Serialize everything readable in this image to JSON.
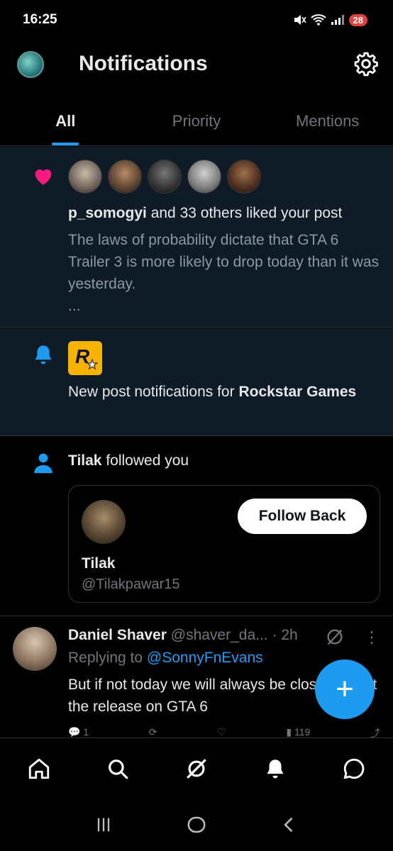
{
  "status_bar": {
    "time": "16:25",
    "battery": "28"
  },
  "header": {
    "title": "Notifications"
  },
  "tabs": [
    {
      "label": "All",
      "active": true
    },
    {
      "label": "Priority",
      "active": false
    },
    {
      "label": "Mentions",
      "active": false
    }
  ],
  "like_notification": {
    "user": "p_somogyi",
    "rest": " and 33 others liked your post",
    "preview": "The laws of probability dictate that GTA 6 Trailer 3 is more likely to drop today than it was yesterday.",
    "ellipsis": "..."
  },
  "post_notification": {
    "prefix": "New post notifications for ",
    "account": "Rockstar Games",
    "logo_letter": "R"
  },
  "follow_notification": {
    "user": "Tilak",
    "rest": " followed you",
    "card_name": "Tilak",
    "card_handle": "@Tilakpawar15",
    "button": "Follow Back"
  },
  "reply": {
    "name": "Daniel Shaver",
    "handle": "@shaver_da...",
    "dot": " · ",
    "time": "2h",
    "replying_prefix": "Replying to ",
    "replying_to": "@SonnyFnEvans",
    "text": "But if not today we will always be closer just let the release on GTA 6",
    "reply_count": "1",
    "views": "119"
  },
  "colors": {
    "accent": "#1d9bf0",
    "like": "#f91880",
    "highlight_bg": "#0f1c28"
  }
}
